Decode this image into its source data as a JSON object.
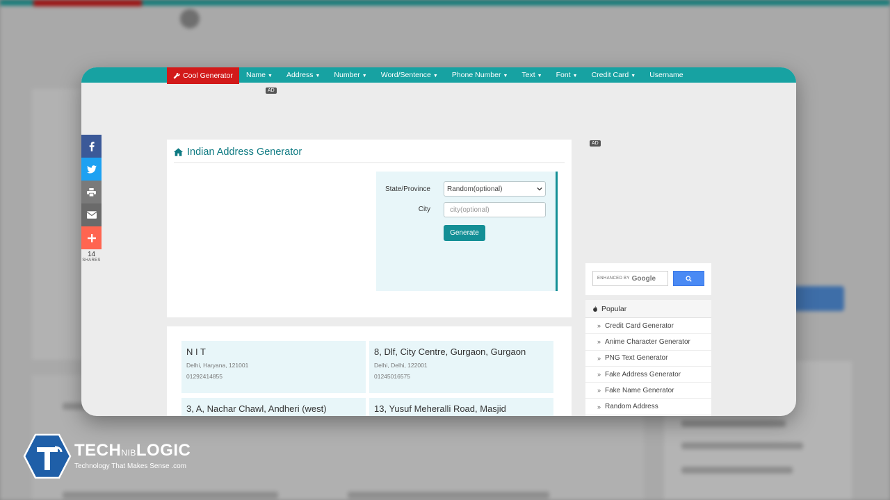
{
  "navbar": {
    "brand": "Cool Generator",
    "items": [
      {
        "label": "Name",
        "dropdown": true
      },
      {
        "label": "Address",
        "dropdown": true
      },
      {
        "label": "Number",
        "dropdown": true
      },
      {
        "label": "Word/Sentence",
        "dropdown": true
      },
      {
        "label": "Phone Number",
        "dropdown": true
      },
      {
        "label": "Text",
        "dropdown": true
      },
      {
        "label": "Font",
        "dropdown": true
      },
      {
        "label": "Credit Card",
        "dropdown": true
      },
      {
        "label": "Username",
        "dropdown": false
      }
    ]
  },
  "ads": {
    "badge": "AD"
  },
  "social": {
    "count": "14",
    "label": "SHARES"
  },
  "form": {
    "title": "Indian Address Generator",
    "state_label": "State/Province",
    "state_value": "Random(optional)",
    "city_label": "City",
    "city_placeholder": "city(optional)",
    "generate_label": "Generate"
  },
  "results": [
    {
      "title": "N I T",
      "location": "Delhi, Haryana, 121001",
      "phone": "01292414855"
    },
    {
      "title": "8, Dlf, City Centre, Gurgaon, Gurgaon",
      "location": "Delhi, Delhi, 122001",
      "phone": "01245016575"
    },
    {
      "title": "3, A, Nachar Chawl, Andheri (west)",
      "location": "",
      "phone": ""
    },
    {
      "title": "13, Yusuf Meheralli Road, Masjid",
      "location": "",
      "phone": ""
    }
  ],
  "search": {
    "enhanced": "ENHANCED BY",
    "google": "Google"
  },
  "popular": {
    "title": "Popular",
    "items": [
      "Credit Card Generator",
      "Anime Character Generator",
      "PNG Text Generator",
      "Fake Address Generator",
      "Fake Name Generator",
      "Random Address"
    ]
  },
  "logo": {
    "tech": "TECH",
    "nib": "NIB",
    "logic": "LOGIC",
    "tagline": "Technology That Makes Sense",
    "dotcom": ".com"
  },
  "colors": {
    "teal": "#17a2a2",
    "brand_red": "#d21a1a",
    "panel": "#e8f6f9",
    "accent": "#138f96"
  }
}
